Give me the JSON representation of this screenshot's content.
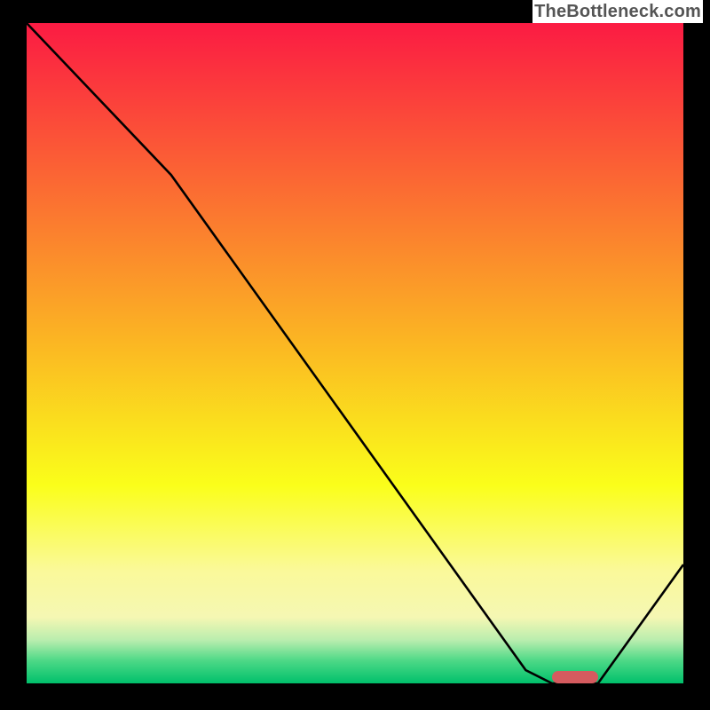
{
  "watermark": "TheBottleneck.com",
  "chart_data": {
    "type": "line",
    "title": "",
    "xlabel": "",
    "ylabel": "",
    "xlim": [
      0,
      100
    ],
    "ylim": [
      0,
      100
    ],
    "x": [
      0,
      22,
      76,
      80,
      87,
      100
    ],
    "values": [
      100,
      77,
      2,
      0,
      0,
      18
    ],
    "annotations": [
      {
        "kind": "min-marker",
        "x_start": 80,
        "x_end": 87,
        "y": 1
      }
    ],
    "background_gradient_stops": [
      {
        "pos": 0.0,
        "color": "#fb1b43"
      },
      {
        "pos": 0.48,
        "color": "#fbb523"
      },
      {
        "pos": 0.7,
        "color": "#fafe1a"
      },
      {
        "pos": 0.83,
        "color": "#faf99a"
      },
      {
        "pos": 0.9,
        "color": "#f5f7b3"
      },
      {
        "pos": 0.935,
        "color": "#b8edae"
      },
      {
        "pos": 0.965,
        "color": "#4fd987"
      },
      {
        "pos": 1.0,
        "color": "#00c06b"
      }
    ]
  }
}
